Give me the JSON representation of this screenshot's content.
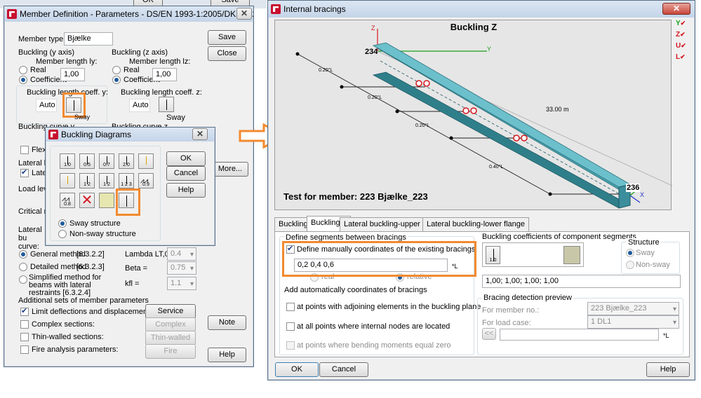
{
  "bg_top": {
    "ok": "OK",
    "save": "Save"
  },
  "member_def": {
    "title": "Member Definition - Parameters - DS/EN 1993-1:2005/DK NA:2013/A...",
    "member_type_label": "Member type:",
    "member_type_value": "Bjælke",
    "save": "Save",
    "close": "Close",
    "buckling_y_title": "Buckling (y axis)",
    "buckling_z_title": "Buckling (z axis)",
    "member_length_y": "Member length ly:",
    "member_length_z": "Member length lz:",
    "real": "Real",
    "coefficient": "Coefficient",
    "coeff_y_value": "1,00",
    "coeff_z_value": "1,00",
    "blc_y": "Buckling length coeff. y:",
    "blc_z": "Buckling length coeff. z:",
    "auto": "Auto",
    "sway": "Sway",
    "curve_y": "Buckling curve y",
    "curve_z": "Buckling curve z",
    "flexural": "Flexura",
    "lateral_title": "Lateral bu",
    "lateral_chk": "Latera",
    "load_level": "Load level",
    "critical": "Critical mo",
    "lateral_curve": "Lateral bu curve:",
    "more": "More...",
    "general_method": "General method",
    "general_ref": "[6.3.2.2]",
    "detailed_method": "Detailed method",
    "detailed_ref": "[6.3.2.3]",
    "simplified_method": "Simplified method for beams with lateral restraints  [6.3.2.4]",
    "lambda_label": "Lambda LT,0 =",
    "lambda_value": "0.4",
    "beta_label": "Beta =",
    "beta_value": "0.75",
    "kfl_label": "kfl =",
    "kfl_value": "1.1",
    "additional_title": "Additional sets of member parameters",
    "limit_defl": "Limit deflections and displacements:",
    "complex": "Complex sections:",
    "thin": "Thin-walled sections:",
    "fire": "Fire analysis parameters:",
    "service_btn": "Service",
    "complex_btn": "Complex",
    "thin_btn": "Thin-walled",
    "fire_btn": "Fire",
    "note": "Note",
    "help": "Help"
  },
  "buckling_diagrams": {
    "title": "Buckling Diagrams",
    "ok": "OK",
    "cancel": "Cancel",
    "help": "Help",
    "sway_structure": "Sway structure",
    "non_sway_structure": "Non-sway structure",
    "row1": [
      "1.0",
      "0.5",
      "0.7",
      "2.0",
      ""
    ],
    "row2": [
      "",
      "1 2",
      "1 2",
      "1 2 3",
      "0.9"
    ],
    "row3": [
      "0.8",
      "",
      "",
      ""
    ]
  },
  "internal_bracings": {
    "title": "Internal bracings",
    "view_title": "Buckling Z",
    "member_label": "Test for member: 223 Bjælke_223",
    "node_start": "234",
    "node_end": "236",
    "length": "33.00  m",
    "axis_z": "Z",
    "axis_y": "Y",
    "axis_x": "X",
    "seg_labels": [
      "0.20°L",
      "0.20°L",
      "0.20°L",
      "0.40°L"
    ],
    "tabs": [
      "Buckling Y",
      "Buckling Z",
      "Lateral buckling-upper flange",
      "Lateral buckling-lower flange"
    ],
    "define_segments_title": "Define segments between bracings",
    "define_manually": "Define manually coordinates of the existing bracings",
    "coords_value": "0,2 0,4 0,6",
    "unit_L": "*L",
    "real": "real",
    "relative": "relative",
    "add_auto_title": "Add automatically coordinates of bracings",
    "auto1": "at points with adjoining elements in the buckling plane",
    "auto2": "at all points where internal nodes are located",
    "auto3": "at points where bending moments equal zero",
    "coeff_title": "Buckling coefficients of component segments",
    "coeff_icon1": "1.0",
    "structure_title": "Structure",
    "sway": "Sway",
    "non_sway": "Non-sway",
    "coeff_values": "1,00; 1,00; 1,00; 1,00",
    "detection_title": "Bracing detection preview",
    "for_member": "For member no.:",
    "for_member_value": "223  Bjælke_223",
    "for_load": "For load case:",
    "for_load_value": "1  DL1",
    "prev": "<<",
    "unit_L2": "*L",
    "ok": "OK",
    "cancel": "Cancel",
    "help": "Help",
    "side_icons": [
      "Y",
      "Z",
      "U",
      "L"
    ]
  },
  "colors": {
    "accent": "#f28a30",
    "beam": "#3c8e9c",
    "bracing_dot": "#d4171f"
  }
}
